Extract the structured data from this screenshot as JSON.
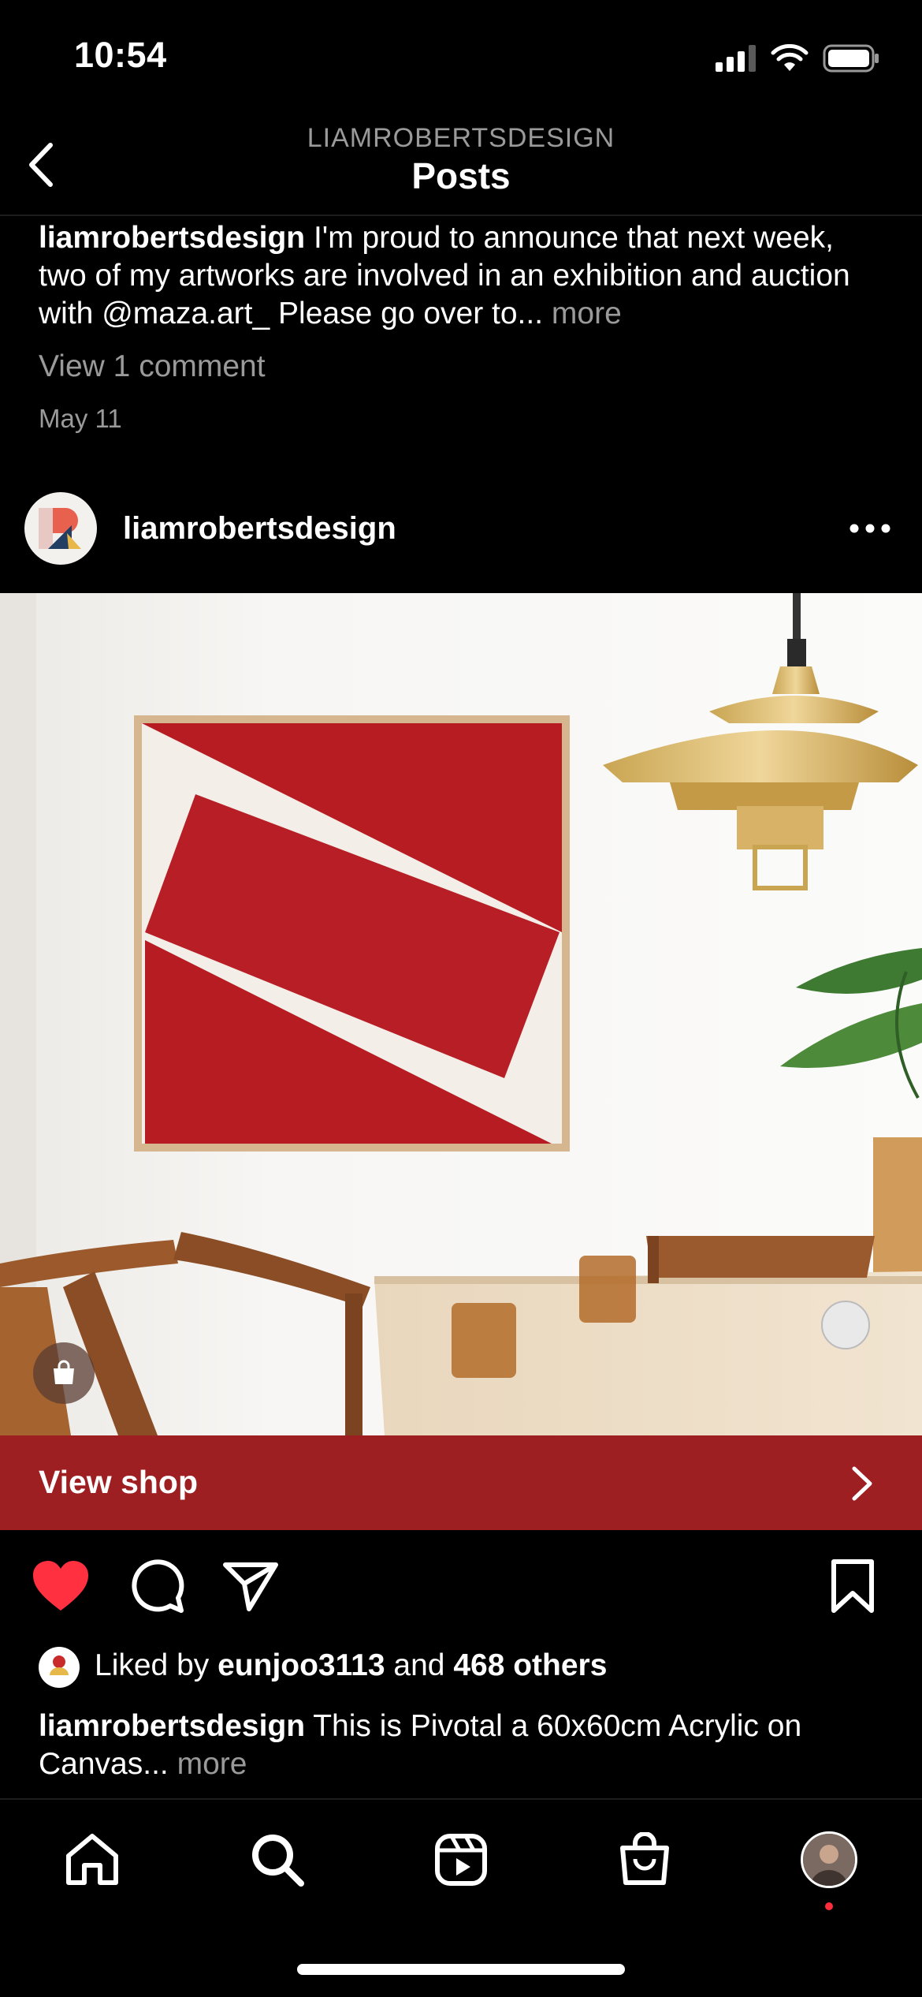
{
  "status_bar": {
    "time": "10:54"
  },
  "header": {
    "subtitle": "LIAMROBERTSDESIGN",
    "title": "Posts"
  },
  "previous_post": {
    "username": "liamrobertsdesign",
    "caption": "I'm proud to announce that next week, two of my artworks are involved in an exhibition and auction with @maza.art_ Please go over to...",
    "more_label": "more",
    "comments_link": "View 1 comment",
    "date": "May 11"
  },
  "post": {
    "username": "liamrobertsdesign",
    "view_shop_label": "View shop",
    "liked_prefix": "Liked by",
    "liked_user": "eunjoo3113",
    "liked_and": "and",
    "liked_others": "468 others",
    "caption_username": "liamrobertsdesign",
    "caption": "This is Pivotal a 60x60cm Acrylic on Canvas...",
    "more_label": "more",
    "liked": true
  },
  "colors": {
    "accent_red": "#9e1f22",
    "like_red": "#ff3040",
    "muted_text": "#9a9a9a"
  },
  "icons": {
    "back": "chevron-left-icon",
    "more": "ellipsis-icon",
    "heart": "heart-icon",
    "comment": "comment-icon",
    "share": "send-icon",
    "bookmark": "bookmark-icon",
    "shop_tag": "shopping-bag-icon",
    "home": "home-icon",
    "search": "search-icon",
    "reels": "reels-icon",
    "shop": "shop-icon"
  }
}
